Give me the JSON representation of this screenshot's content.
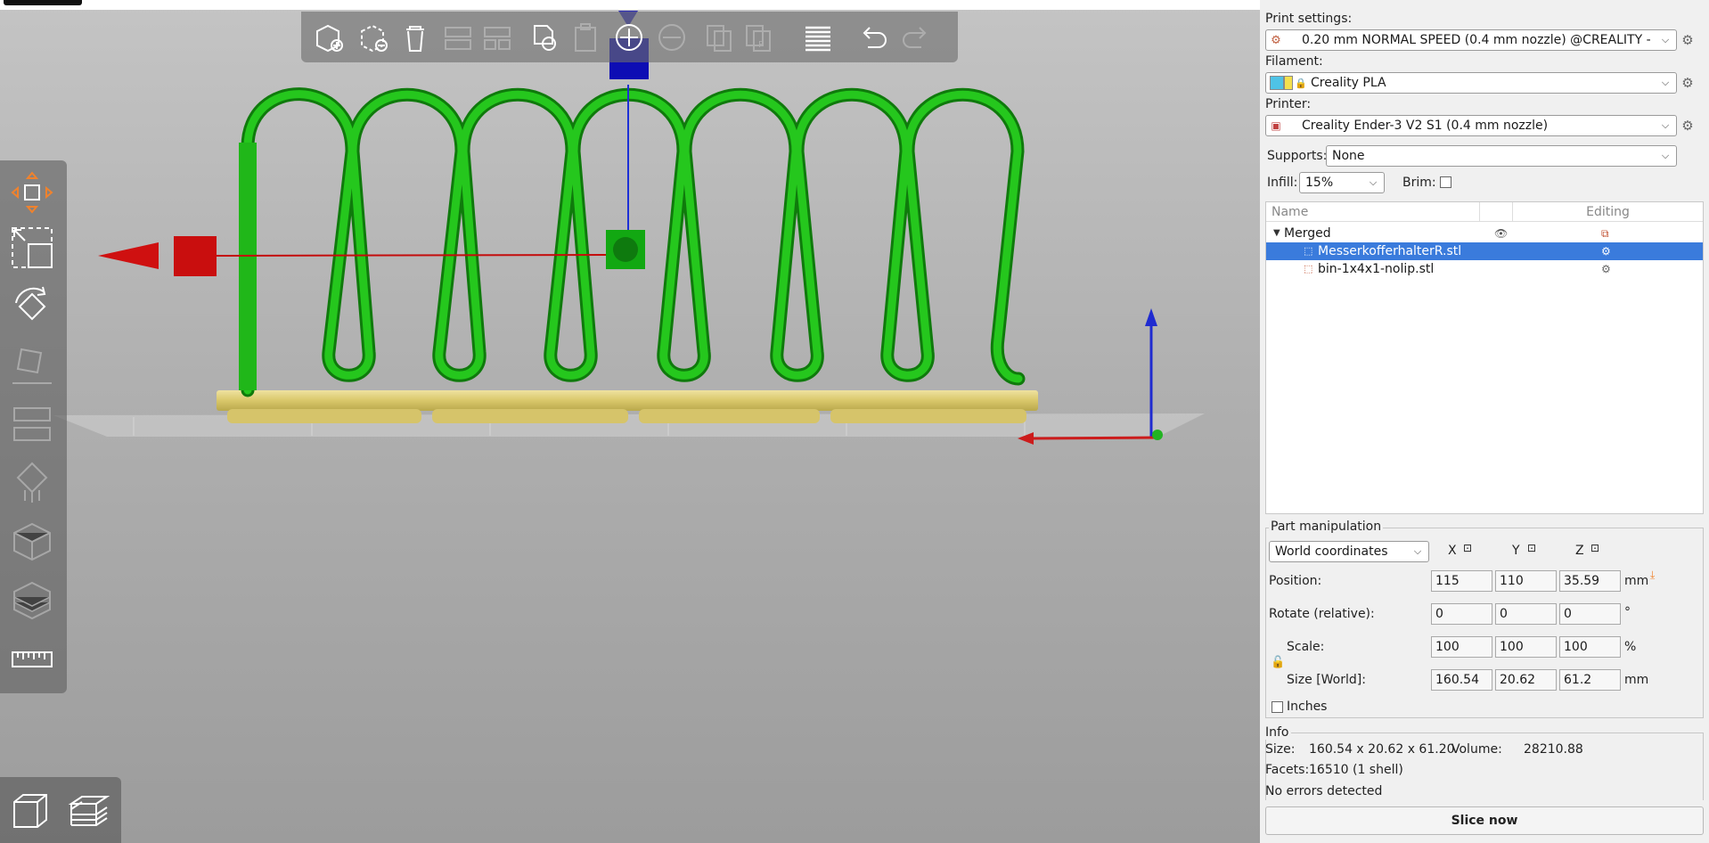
{
  "viewport": {
    "toolbar_icons": [
      "add-part-icon",
      "delete-part-icon",
      "delete-all-icon",
      "arrange-icon",
      "arrange-selection-icon",
      "copy-icon",
      "paste-icon",
      "add-instance-icon",
      "remove-instance-icon",
      "split-objects-icon",
      "split-parts-icon",
      "layers-editing-icon",
      "undo-icon",
      "redo-icon"
    ],
    "left_tools": [
      "move-tool-icon",
      "scale-tool-icon",
      "rotate-tool-icon",
      "place-on-face-icon",
      "cut-tool-icon",
      "support-paint-icon",
      "seam-paint-icon",
      "mmu-paint-icon",
      "measure-tool-icon"
    ],
    "view_modes": [
      "3d-view-icon",
      "preview-view-icon"
    ]
  },
  "print_settings": {
    "label": "Print settings:",
    "value": "0.20 mm NORMAL SPEED (0.4 mm nozzle) @CREALITY - ..."
  },
  "filament": {
    "label": "Filament:",
    "value": "Creality PLA",
    "color": "#4ec3e6"
  },
  "printer": {
    "label": "Printer:",
    "value": "Creality Ender-3 V2 S1 (0.4 mm nozzle)"
  },
  "supports": {
    "label": "Supports:",
    "value": "None"
  },
  "infill": {
    "label": "Infill:",
    "value": "15%"
  },
  "brim": {
    "label": "Brim:",
    "checked": false
  },
  "object_list": {
    "col_name": "Name",
    "col_editing": "Editing",
    "root": "Merged",
    "parts": [
      "MesserkofferhalterR.stl",
      "bin-1x4x1-nolip.stl"
    ]
  },
  "part_manipulation": {
    "title": "Part manipulation",
    "coord_system": "World coordinates",
    "axes": [
      "X",
      "Y",
      "Z"
    ],
    "position": {
      "label": "Position:",
      "x": "115",
      "y": "110",
      "z": "35.59",
      "unit": "mm"
    },
    "rotate": {
      "label": "Rotate (relative):",
      "x": "0",
      "y": "0",
      "z": "0",
      "unit": "°"
    },
    "scale": {
      "label": "Scale:",
      "x": "100",
      "y": "100",
      "z": "100",
      "unit": "%"
    },
    "size": {
      "label": "Size [World]:",
      "x": "160.54",
      "y": "20.62",
      "z": "61.2",
      "unit": "mm"
    },
    "inches_label": "Inches"
  },
  "info": {
    "title": "Info",
    "size_label": "Size:",
    "size_value": "160.54 x 20.62 x 61.20",
    "volume_label": "Volume:",
    "volume_value": "28210.88",
    "facets_label": "Facets:",
    "facets_value": "16510 (1 shell)",
    "status": "No errors detected"
  },
  "slice_button": "Slice now",
  "colors": {
    "accent": "#f0822d",
    "selection": "#3a7bdc",
    "model_green": "#22c41c",
    "model_base": "#e0d27a"
  }
}
